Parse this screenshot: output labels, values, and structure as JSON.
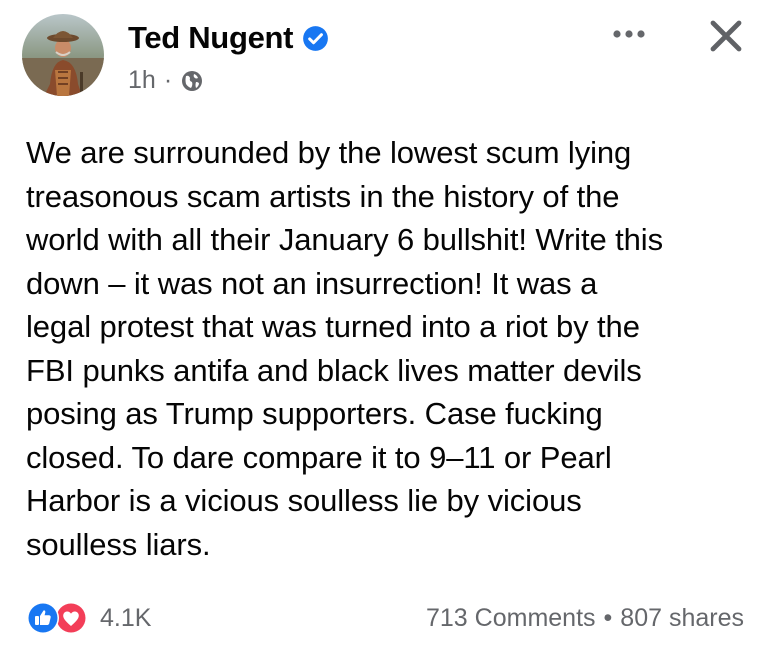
{
  "post": {
    "author": "Ted Nugent",
    "timestamp": "1h",
    "meta_separator": "·",
    "privacy_icon": "globe-icon",
    "verified_icon": "verified-badge-icon",
    "more_icon": "more-options-icon",
    "close_icon": "close-icon",
    "text": "We are surrounded by the lowest scum lying\ntreasonous scam artists in the history of the\nworld with all their January 6 bullshit! Write this\ndown – it was not an insurrection! It was a\nlegal protest that was turned into a riot by the\nFBI punks antifa and black lives matter devils\nposing as Trump supporters. Case fucking\nclosed. To dare compare it to 9–11 or Pearl\nHarbor is a vicious soulless lie by vicious\nsoulless liars."
  },
  "footer": {
    "reaction_icons": [
      "like-icon",
      "love-icon"
    ],
    "reaction_count": "4.1K",
    "comments": "713 Comments",
    "separator": "•",
    "shares": "807 shares"
  },
  "colors": {
    "text": "#050505",
    "secondary_text": "#65676b",
    "facebook_blue": "#1877f2",
    "love_red": "#f33e58",
    "background": "#ffffff"
  }
}
